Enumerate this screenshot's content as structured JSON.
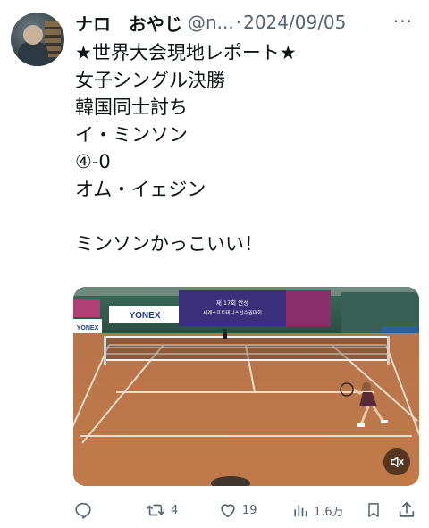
{
  "tweet": {
    "display_name": "ナロ　おやじ",
    "handle": "@n...",
    "separator": "·",
    "date": "2024/09/05",
    "more_label": "···",
    "lines": [
      "★世界大会現地レポート★",
      "女子シングル決勝",
      "韓国同士討ち",
      "イ・ミンソン",
      "④-0",
      "オム・イェジン",
      "",
      "ミンソンかっこいい！"
    ]
  },
  "media": {
    "banner_brand": "YONEX",
    "banner_title": "제 17회 안성",
    "banner_subtitle": "세계소프트테니스선수권대회",
    "side_brand": "YONEX",
    "mute_icon": "speaker-muted-icon"
  },
  "actions": {
    "reply_count": "",
    "retweet_count": "4",
    "like_count": "19",
    "views_count": "1.6万"
  }
}
